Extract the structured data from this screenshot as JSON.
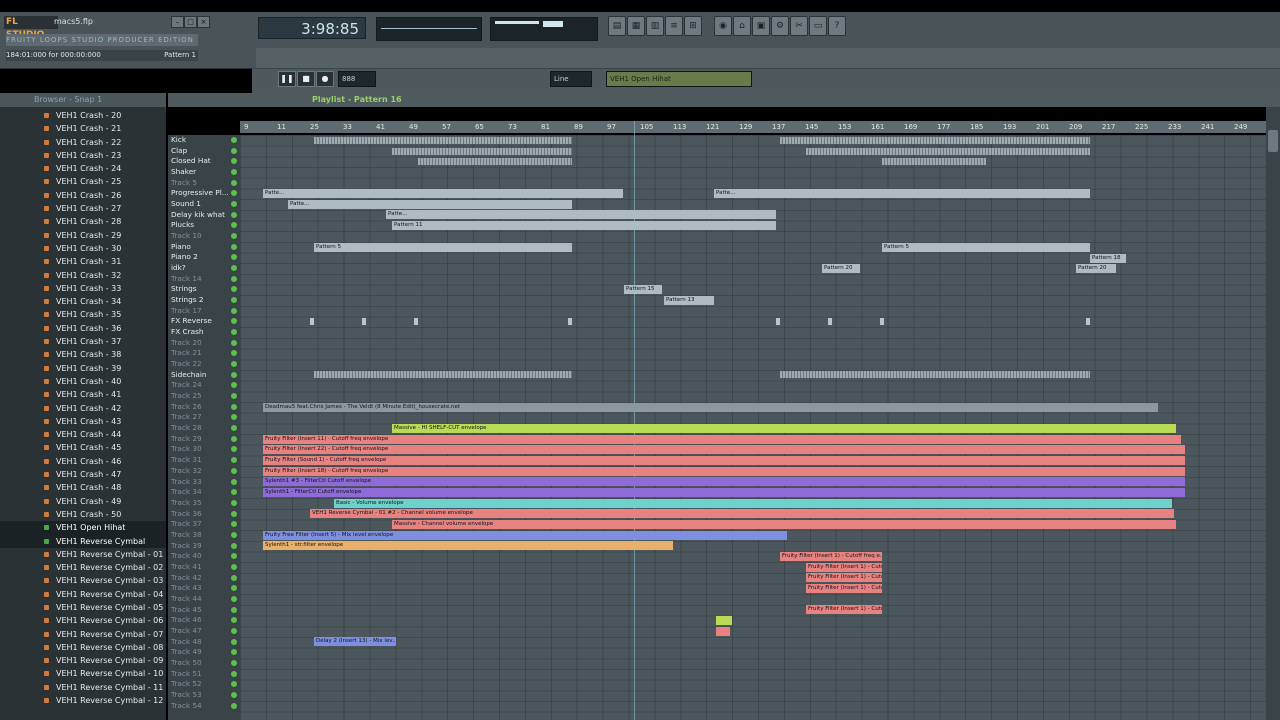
{
  "app": {
    "logo": "FL STUDIO",
    "file": "macs5.flp",
    "hint": "FRUITY LOOPS STUDIO PRODUCER EDITION",
    "status": "184:01:000 for 000:00:000",
    "pattern_label": "Pattern 1"
  },
  "transport": {
    "time": "3:98:85",
    "snap": "Line",
    "plugin": "VEH1 Open Hihat"
  },
  "browser": {
    "title": "Browser - Snap 1",
    "items": [
      "VEH1 Crash - 20",
      "VEH1 Crash - 21",
      "VEH1 Crash - 22",
      "VEH1 Crash - 23",
      "VEH1 Crash - 24",
      "VEH1 Crash - 25",
      "VEH1 Crash - 26",
      "VEH1 Crash - 27",
      "VEH1 Crash - 28",
      "VEH1 Crash - 29",
      "VEH1 Crash - 30",
      "VEH1 Crash - 31",
      "VEH1 Crash - 32",
      "VEH1 Crash - 33",
      "VEH1 Crash - 34",
      "VEH1 Crash - 35",
      "VEH1 Crash - 36",
      "VEH1 Crash - 37",
      "VEH1 Crash - 38",
      "VEH1 Crash - 39",
      "VEH1 Crash - 40",
      "VEH1 Crash - 41",
      "VEH1 Crash - 42",
      "VEH1 Crash - 43",
      "VEH1 Crash - 44",
      "VEH1 Crash - 45",
      "VEH1 Crash - 46",
      "VEH1 Crash - 47",
      "VEH1 Crash - 48",
      "VEH1 Crash - 49",
      "VEH1 Crash - 50",
      "VEH1 Open Hihat",
      "VEH1 Reverse Cymbal",
      "VEH1 Reverse Cymbal - 01",
      "VEH1 Reverse Cymbal - 02",
      "VEH1 Reverse Cymbal - 03",
      "VEH1 Reverse Cymbal - 04",
      "VEH1 Reverse Cymbal - 05",
      "VEH1 Reverse Cymbal - 06",
      "VEH1 Reverse Cymbal - 07",
      "VEH1 Reverse Cymbal - 08",
      "VEH1 Reverse Cymbal - 09",
      "VEH1 Reverse Cymbal - 10",
      "VEH1 Reverse Cymbal - 11",
      "VEH1 Reverse Cymbal - 12"
    ]
  },
  "playlist": {
    "title": "Playlist - Pattern 16",
    "ruler": [
      "9",
      "11",
      "25",
      "33",
      "41",
      "49",
      "57",
      "65",
      "73",
      "81",
      "89",
      "97",
      "105",
      "113",
      "121",
      "129",
      "137",
      "145",
      "153",
      "161",
      "169",
      "177",
      "185",
      "193",
      "201",
      "209",
      "217",
      "225",
      "233",
      "241",
      "249"
    ],
    "tracks": [
      "Kick",
      "Clap",
      "Closed Hat",
      "Shaker",
      "Track 5",
      "Progressive Pl...",
      "Sound 1",
      "Delay kik what",
      "Plucks",
      "Track 10",
      "Piano",
      "Piano 2",
      "idk?",
      "Track 14",
      "Strings",
      "Strings 2",
      "Track 17",
      "FX Reverse",
      "FX Crash",
      "Track 20",
      "Track 21",
      "Track 22",
      "Sidechain",
      "Track 24",
      "Track 25",
      "Track 26",
      "Track 27",
      "Track 28",
      "Track 29",
      "Track 30",
      "Track 31",
      "Track 32",
      "Track 33",
      "Track 34",
      "Track 35",
      "Track 36",
      "Track 37",
      "Track 38",
      "Track 39",
      "Track 40",
      "Track 41",
      "Track 42",
      "Track 43",
      "Track 44",
      "Track 45",
      "Track 46",
      "Track 47",
      "Track 48",
      "Track 49",
      "Track 50",
      "Track 51",
      "Track 52",
      "Track 53",
      "Track 54"
    ]
  },
  "clips": {
    "audio": "Deadmau5 feat.Chris James - The Veldt (8 Minute Edit)_housecrate.net",
    "massive": "Massive - HI SHELF-CUT envelope",
    "filter1": "Fruity Filter (Insert 11) - Cutoff freq envelope",
    "filter2": "Fruity Filter (Insert 22) - Cutoff freq envelope",
    "filter3": "Fruity Filter (Sound 1) - Cutoff freq envelope",
    "filter4": "Fruity Filter (Insert 18) - Cutoff freq envelope",
    "syl1": "Sylenth1 #3 - FilterCtl Cutoff envelope",
    "syl2": "Sylenth1 - FilterCtl Cutoff envelope",
    "basic": "Basic - Volume envelope",
    "reverse": "VEH1 Reverse Cymbal - 01 #2 - Channel volume envelope",
    "massive2": "Massive - Channel volume envelope",
    "fourband": "Fruity Free Filter (Insert 5) - Mix level envelope",
    "syl3": "Sylenth1 - str.filter envelope",
    "delay": "Delay 2 (Insert 13) - Mix lev...",
    "ff": "Fruity Filter (Insert 1) - Cutoff freq e...",
    "pattern5": "Pattern 5",
    "pattern11": "Pattern 11",
    "pattern13": "Pattern 13",
    "pattern15": "Pattern 15",
    "pattern18": "Pattern 18",
    "pattern20": "Pattern 20",
    "patt": "Patte..."
  }
}
